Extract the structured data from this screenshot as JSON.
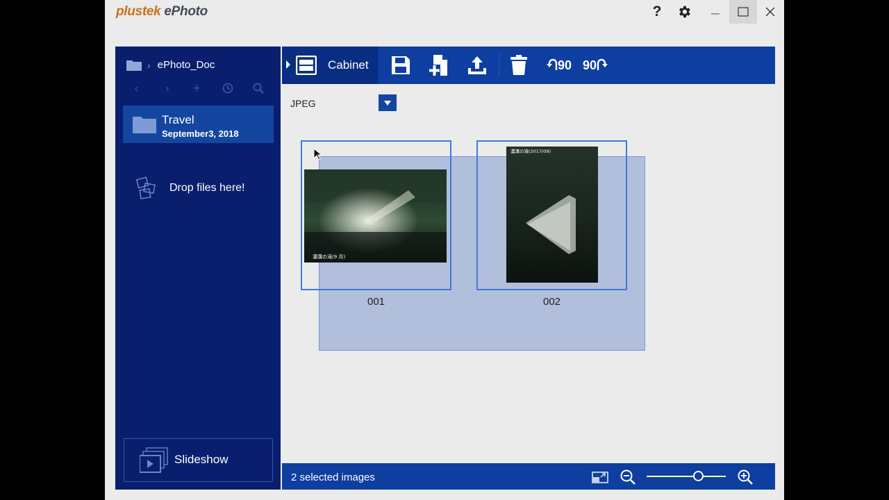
{
  "app": {
    "brand_part1": "plustek",
    "brand_part2": " ePhoto",
    "help_label": "?",
    "colors": {
      "sidebar": "#0a1e6e",
      "toolbar": "#0d3ea0",
      "accent": "#c8711e",
      "selection_border": "#3f7ad8"
    }
  },
  "sidebar": {
    "breadcrumb_root_icon": "folder-icon",
    "breadcrumb_label": "ePhoto_Doc",
    "nav_icons": [
      "back-icon",
      "forward-icon",
      "add-icon",
      "history-icon",
      "search-icon"
    ],
    "folder": {
      "name": "Travel",
      "date": "September3, 2018"
    },
    "drop_label": "Drop files here!",
    "slideshow_label": "Slideshow"
  },
  "toolbar": {
    "cabinet_label": "Cabinet",
    "rotate_left_label": "90",
    "rotate_right_label": "90",
    "tools": [
      "save-icon",
      "add-page-icon",
      "upload-icon",
      "delete-icon",
      "rotate-left-icon",
      "rotate-right-icon"
    ]
  },
  "content": {
    "format_value": "JPEG",
    "thumbnails": [
      {
        "caption": "001",
        "overlay_text": "濃溝の滝(9 月)"
      },
      {
        "caption": "002",
        "overlay_text": "濃溝の滝(2017/09)"
      }
    ]
  },
  "status": {
    "selected_text": "2 selected images",
    "zoom_level": 0.65
  }
}
